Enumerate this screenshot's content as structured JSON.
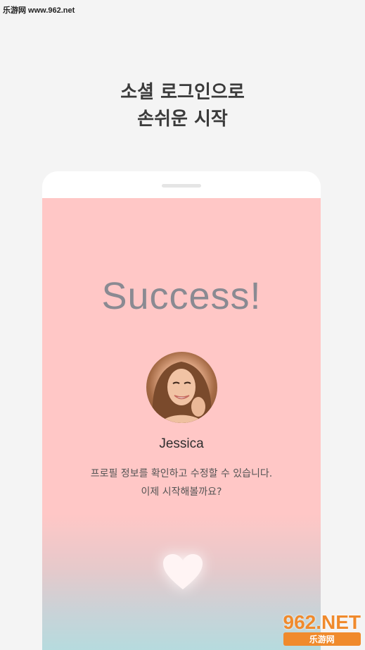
{
  "watermark": {
    "top_text": "乐游网 www.962.net",
    "bottom_main": "962.NET",
    "bottom_sub": "乐游网"
  },
  "headline": {
    "line1": "소셜 로그인으로",
    "line2": "손쉬운 시작"
  },
  "screen": {
    "title": "Success!",
    "user_name": "Jessica",
    "description_line1": "프로필 정보를 확인하고 수정할 수 있습니다.",
    "description_line2": "이제 시작해볼까요?",
    "avatar_icon": "profile-photo",
    "heart_icon": "heart-icon"
  },
  "colors": {
    "background": "#f4f4f4",
    "screen_pink": "#ffc7c6",
    "screen_teal": "#b6dbde",
    "title_gray": "#8a8a92",
    "headline_dark": "#3b3b3b"
  }
}
